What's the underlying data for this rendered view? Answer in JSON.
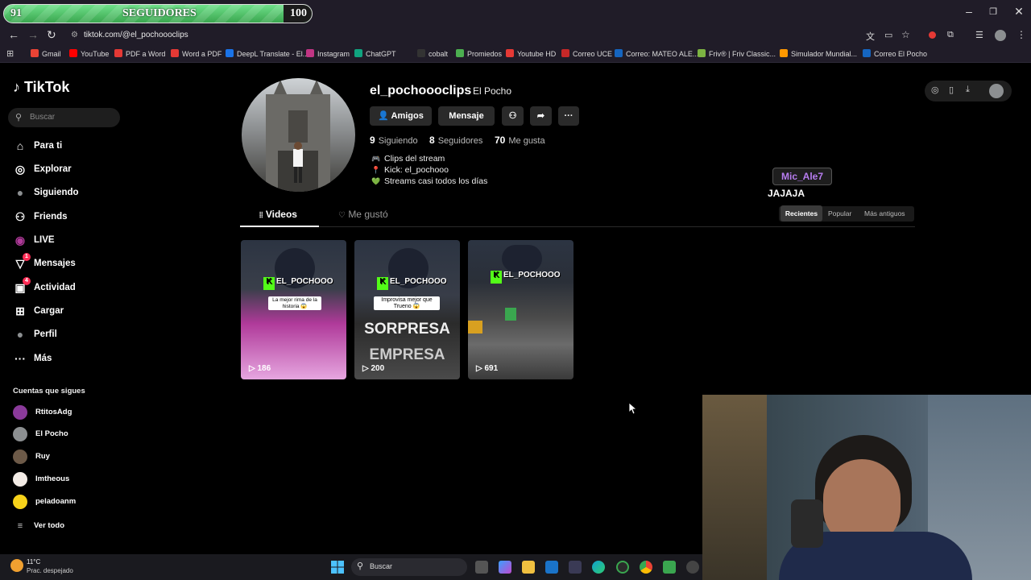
{
  "overlay": {
    "progress_left": "91",
    "progress_label": "SEGUIDORES",
    "progress_right": "100",
    "progress_fraction": 0.91
  },
  "browser": {
    "url": "tiktok.com/@el_pochoooclips",
    "bookmarks": [
      "Gmail",
      "YouTube",
      "PDF a Word",
      "Word a PDF",
      "DeepL Translate - El...",
      "Instagram",
      "ChatGPT",
      "cobalt",
      "Promiedos",
      "Youtube HD",
      "Correo UCE",
      "Correo: MATEO ALE...",
      "Friv® | Friv Classic...",
      "Simulador Mundial...",
      "Correo El Pocho"
    ],
    "bookmark_colors": [
      "#ea4335",
      "#ff0000",
      "#e53935",
      "#e53935",
      "#1a73e8",
      "#c13584",
      "#10a37f",
      "#333333",
      "#4caf50",
      "#e53935",
      "#c62828",
      "#1565c0",
      "#7cb342",
      "#ff9800",
      "#1565c0"
    ]
  },
  "sidebar": {
    "logo": "TikTok",
    "search_placeholder": "Buscar",
    "nav": [
      {
        "label": "Para ti",
        "icon": "home-icon"
      },
      {
        "label": "Explorar",
        "icon": "compass-icon"
      },
      {
        "label": "Siguiendo",
        "icon": "following-avatar-icon"
      },
      {
        "label": "Friends",
        "icon": "friends-icon"
      },
      {
        "label": "LIVE",
        "icon": "live-icon"
      },
      {
        "label": "Mensajes",
        "icon": "messages-icon",
        "badge": "1"
      },
      {
        "label": "Actividad",
        "icon": "activity-icon",
        "badge": "4"
      },
      {
        "label": "Cargar",
        "icon": "upload-icon"
      },
      {
        "label": "Perfil",
        "icon": "profile-icon"
      },
      {
        "label": "Más",
        "icon": "more-icon"
      }
    ],
    "following_title": "Cuentas que sigues",
    "following": [
      {
        "name": "RtitosAdg",
        "color": "#8a3a9a"
      },
      {
        "name": "El Pocho",
        "color": "#8c8f91"
      },
      {
        "name": "Ruy",
        "color": "#6d5a48"
      },
      {
        "name": "Imtheous",
        "color": "#f3ece6"
      },
      {
        "name": "peladoanm",
        "color": "#f7d21a"
      }
    ],
    "see_all": "Ver todo"
  },
  "profile": {
    "username": "el_pochoooclips",
    "nickname": "El Pocho",
    "buttons": {
      "friends": "Amigos",
      "message": "Mensaje"
    },
    "stats": [
      {
        "value": "9",
        "label": "Siguiendo"
      },
      {
        "value": "8",
        "label": "Seguidores"
      },
      {
        "value": "70",
        "label": "Me gusta"
      }
    ],
    "bio": [
      {
        "emoji": "🎮",
        "text": "Clips del stream"
      },
      {
        "emoji": "📍",
        "text": "Kick: el_pochooo"
      },
      {
        "emoji": "💚",
        "text": "Streams casi todos los días"
      }
    ],
    "tabs": {
      "videos": "Videos",
      "liked": "Me gustó"
    },
    "sort": {
      "recent": "Recientes",
      "popular": "Popular",
      "oldest": "Más antiguos"
    }
  },
  "videos": [
    {
      "views": "186",
      "badge": "EL_POCHOOO",
      "caption": "La mejor rima de la historia 😱"
    },
    {
      "views": "200",
      "badge": "EL_POCHOOO",
      "caption": "Improvisa mejor que Trueno 😱",
      "overlay1": "SORPRESA",
      "overlay2": "EMPRESA"
    },
    {
      "views": "691",
      "badge": "EL_POCHOOO"
    }
  ],
  "chat": {
    "user": "Mic_Ale7",
    "message": "JAJAJA"
  },
  "taskbar": {
    "weather_temp": "11°C",
    "weather_desc": "Prac. despejado",
    "search": "Buscar"
  }
}
